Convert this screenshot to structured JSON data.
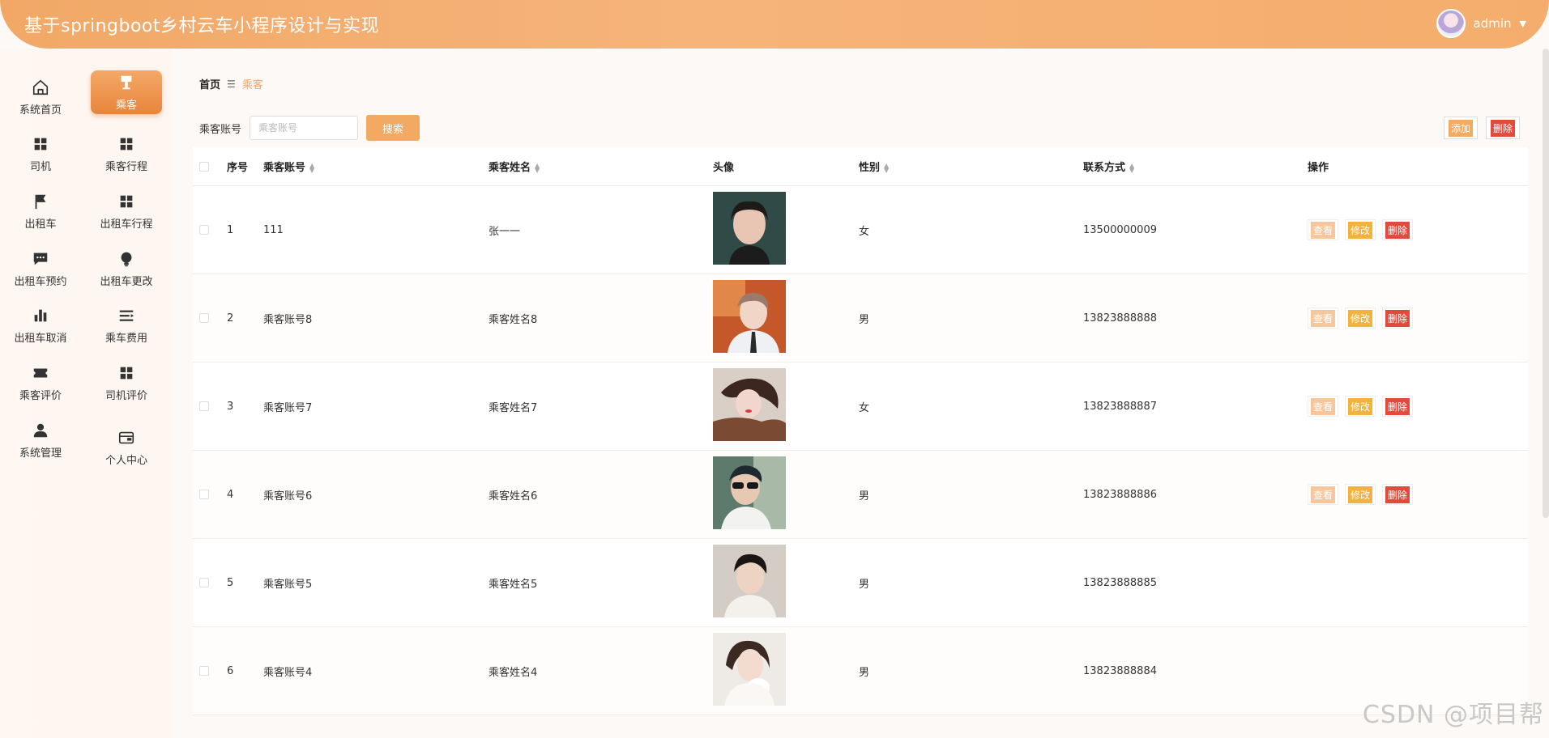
{
  "header": {
    "title": "基于springboot乡村云车小程序设计与实现",
    "username": "admin"
  },
  "sidebar": {
    "items": [
      {
        "label": "系统首页",
        "icon": "home-icon",
        "active": false
      },
      {
        "label": "乘客",
        "icon": "passenger-icon",
        "active": true
      },
      {
        "label": "司机",
        "icon": "grid-icon",
        "active": false
      },
      {
        "label": "乘客行程",
        "icon": "grid-icon",
        "active": false
      },
      {
        "label": "出租车",
        "icon": "flag-icon",
        "active": false
      },
      {
        "label": "出租车行程",
        "icon": "grid-icon",
        "active": false
      },
      {
        "label": "出租车预约",
        "icon": "chat-icon",
        "active": false
      },
      {
        "label": "出租车更改",
        "icon": "bulb-icon",
        "active": false
      },
      {
        "label": "出租车取消",
        "icon": "bar-chart-icon",
        "active": false
      },
      {
        "label": "乘车费用",
        "icon": "list-icon",
        "active": false
      },
      {
        "label": "乘客评价",
        "icon": "ticket-icon",
        "active": false
      },
      {
        "label": "司机评价",
        "icon": "grid-icon",
        "active": false
      },
      {
        "label": "系统管理",
        "icon": "user-icon",
        "active": false
      },
      {
        "label": "个人中心",
        "icon": "wallet-icon",
        "active": false
      }
    ]
  },
  "breadcrumb": {
    "home": "首页",
    "separator": "☰",
    "current": "乘客"
  },
  "search": {
    "label": "乘客账号",
    "placeholder": "乘客账号",
    "button": "搜索"
  },
  "actions": {
    "add": "添加",
    "delete": "删除"
  },
  "table": {
    "headers": {
      "index": "序号",
      "account": "乘客账号",
      "name": "乘客姓名",
      "photo": "头像",
      "gender": "性别",
      "phone": "联系方式",
      "ops": "操作"
    },
    "ops": {
      "view": "查看",
      "edit": "修改",
      "remove": "删除"
    },
    "rows": [
      {
        "index": "1",
        "account": "111",
        "name": "张一一",
        "gender": "女",
        "phone": "13500000009"
      },
      {
        "index": "2",
        "account": "乘客账号8",
        "name": "乘客姓名8",
        "gender": "男",
        "phone": "13823888888"
      },
      {
        "index": "3",
        "account": "乘客账号7",
        "name": "乘客姓名7",
        "gender": "女",
        "phone": "13823888887"
      },
      {
        "index": "4",
        "account": "乘客账号6",
        "name": "乘客姓名6",
        "gender": "男",
        "phone": "13823888886"
      },
      {
        "index": "5",
        "account": "乘客账号5",
        "name": "乘客姓名5",
        "gender": "男",
        "phone": "13823888885"
      },
      {
        "index": "6",
        "account": "乘客账号4",
        "name": "乘客姓名4",
        "gender": "男",
        "phone": "13823888884"
      }
    ]
  },
  "watermark": "CSDN @项目帮"
}
